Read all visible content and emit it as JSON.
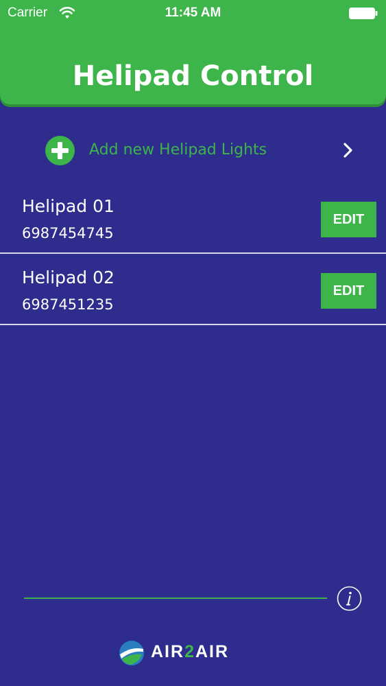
{
  "status_bar": {
    "carrier": "Carrier",
    "time": "11:45 AM"
  },
  "header": {
    "title": "Helipad Control"
  },
  "add_row": {
    "label": "Add new Helipad Lights"
  },
  "helipads": [
    {
      "name": "Helipad 01",
      "phone": "6987454745",
      "edit_label": "EDIT"
    },
    {
      "name": "Helipad 02",
      "phone": "6987451235",
      "edit_label": "EDIT"
    }
  ],
  "footer": {
    "logo_part1": "AIR",
    "logo_part2": "2",
    "logo_part3": "AIR"
  },
  "colors": {
    "background": "#2e2c8c",
    "accent": "#3db54a",
    "text": "#ffffff"
  },
  "icons": [
    "wifi-icon",
    "battery-icon",
    "plus-circle-icon",
    "chevron-right-icon",
    "info-icon",
    "logo-icon"
  ]
}
